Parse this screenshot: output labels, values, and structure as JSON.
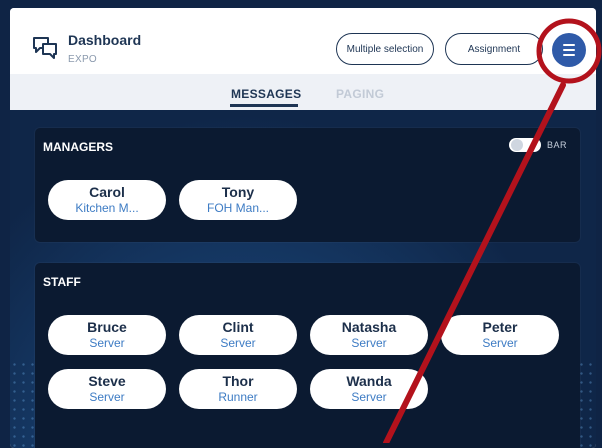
{
  "header": {
    "title": "Dashboard",
    "subtitle": "EXPO",
    "multiple_selection_label": "Multiple selection",
    "assignment_label": "Assignment",
    "menu_icon": "hamburger-icon"
  },
  "tabs": [
    {
      "label": "MESSAGES",
      "active": true
    },
    {
      "label": "PAGING",
      "active": false
    }
  ],
  "managers": {
    "title": "MANAGERS",
    "toggle_label": "BAR",
    "toggle_on": false,
    "people": [
      {
        "name": "Carol",
        "role": "Kitchen M..."
      },
      {
        "name": "Tony",
        "role": "FOH Man..."
      }
    ]
  },
  "staff": {
    "title": "STAFF",
    "people": [
      {
        "name": "Bruce",
        "role": "Server"
      },
      {
        "name": "Clint",
        "role": "Server"
      },
      {
        "name": "Natasha",
        "role": "Server"
      },
      {
        "name": "Peter",
        "role": "Server"
      },
      {
        "name": "Steve",
        "role": "Server"
      },
      {
        "name": "Thor",
        "role": "Runner"
      },
      {
        "name": "Wanda",
        "role": "Server"
      }
    ]
  },
  "colors": {
    "accent": "#2f5aa8",
    "annotation": "#b3121c",
    "panel_bg": "#0b1a31"
  }
}
